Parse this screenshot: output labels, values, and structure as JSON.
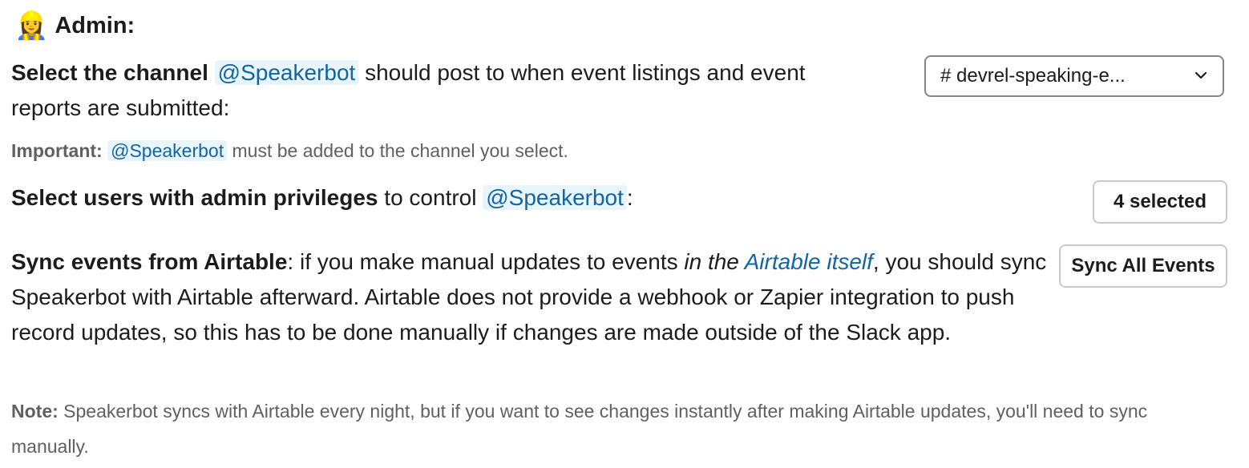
{
  "header": {
    "emoji": "👷‍♀️",
    "title": "Admin:"
  },
  "channel_section": {
    "bold_prefix": "Select the channel",
    "mention": "@Speakerbot",
    "text_suffix": " should post to when event listings and event reports are submitted:",
    "select_value": "# devrel-speaking-e...",
    "note_label": "Important:",
    "note_mention": "@Speakerbot",
    "note_text": " must be added to the channel you select."
  },
  "admins_section": {
    "bold_prefix": "Select users with admin privileges",
    "text_mid": " to control ",
    "mention": "@Speakerbot",
    "text_suffix": ":",
    "button_label": "4 selected"
  },
  "sync_section": {
    "bold_prefix": "Sync events from Airtable",
    "text_a": ": if you make manual updates to events ",
    "italic_text": "in the ",
    "link_text": "Airtable itself",
    "text_b": ", you should sync Speakerbot with Airtable afterward. Airtable does not provide a webhook or Zapier integration to push record updates, so this has to be done manually if changes are made outside of the Slack app.",
    "button_label": "Sync All Events",
    "note_label": "Note:",
    "note_text": " Speakerbot syncs with Airtable every night, but if you want to see changes instantly after making Airtable updates, you'll need to sync manually."
  }
}
